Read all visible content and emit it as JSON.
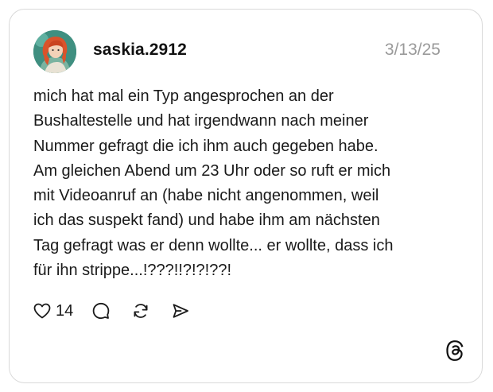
{
  "post": {
    "username": "saskia.2912",
    "date": "3/13/25",
    "text": "mich hat mal ein Typ angesprochen an der\nBushaltestelle und hat irgendwann nach meiner\nNummer gefragt die ich ihm auch gegeben habe.\nAm gleichen Abend um 23 Uhr oder so ruft er mich\nmit Videoanruf an (habe nicht angenommen, weil\nich das suspekt fand) und habe ihm am nächsten\nTag gefragt was er denn wollte... er wollte, dass ich\nfür ihn strippe...!???!!?!?!??!"
  },
  "actions": {
    "like_count": "14",
    "icons": [
      "heart-icon",
      "comment-icon",
      "repost-icon",
      "share-icon"
    ]
  },
  "branding": {
    "logo": "threads-logo-icon"
  },
  "colors": {
    "card_border": "#d9d9d9",
    "username": "#111111",
    "date": "#9a9a9a",
    "text": "#1a1a1a"
  }
}
